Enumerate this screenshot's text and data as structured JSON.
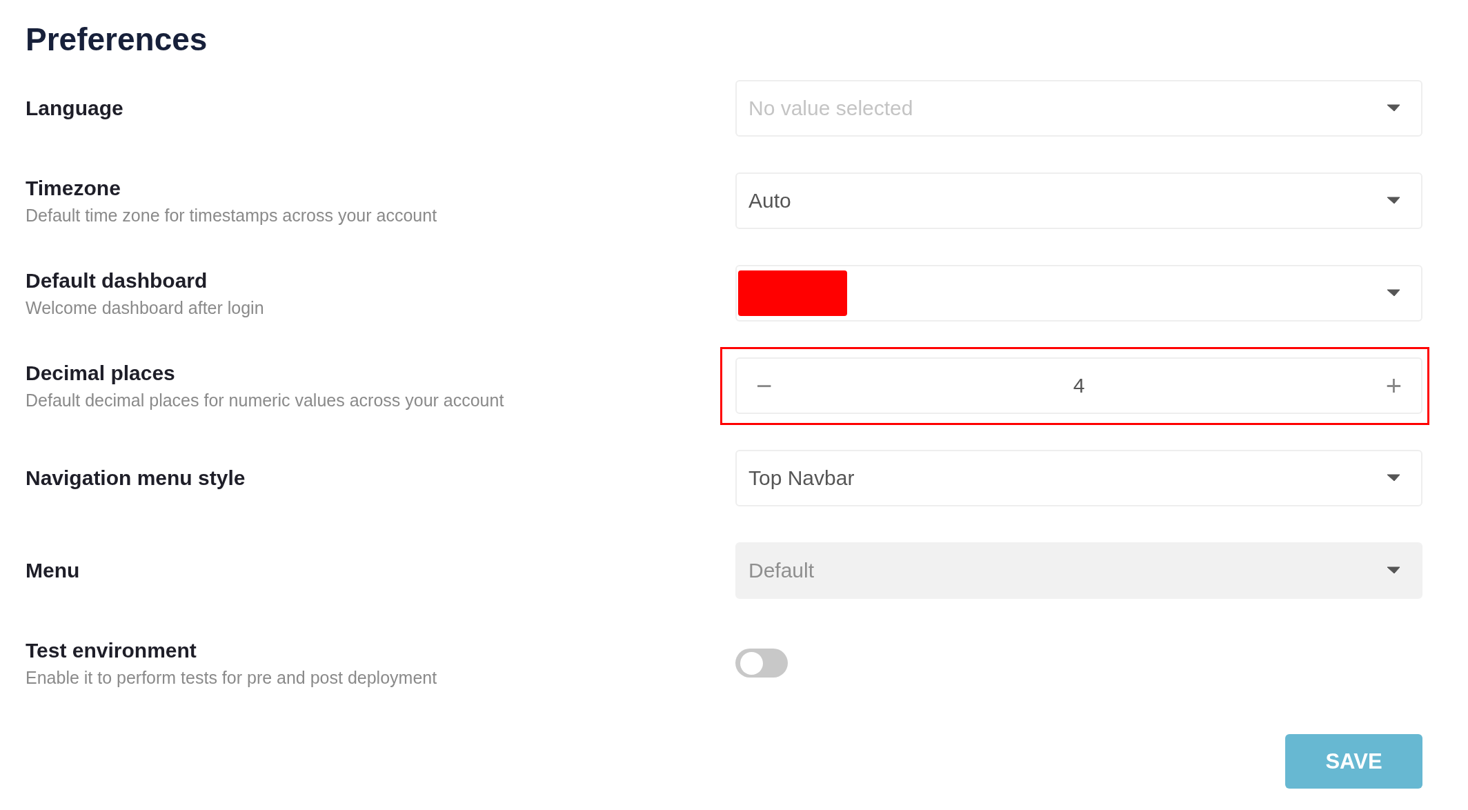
{
  "title": "Preferences",
  "rows": [
    {
      "kind": "select",
      "label": "Language",
      "placeholder": "No value selected",
      "disabled": false
    },
    {
      "kind": "select",
      "label": "Timezone",
      "description": "Default time zone for timestamps across your account",
      "value": "Auto",
      "disabled": false
    },
    {
      "kind": "color_select",
      "label": "Default dashboard",
      "description": "Welcome dashboard after login",
      "color": "#ff0000"
    },
    {
      "kind": "stepper",
      "label": "Decimal places",
      "description": "Default decimal places for numeric values across your account",
      "value": "4",
      "minus": "−",
      "plus": "+",
      "highlighted": true
    },
    {
      "kind": "select",
      "label": "Navigation menu style",
      "value": "Top Navbar",
      "disabled": false
    },
    {
      "kind": "select",
      "label": "Menu",
      "value": "Default",
      "disabled": true
    },
    {
      "kind": "toggle",
      "label": "Test environment",
      "description": "Enable it to perform tests for pre and post deployment",
      "on": false
    }
  ],
  "save_button": "SAVE"
}
